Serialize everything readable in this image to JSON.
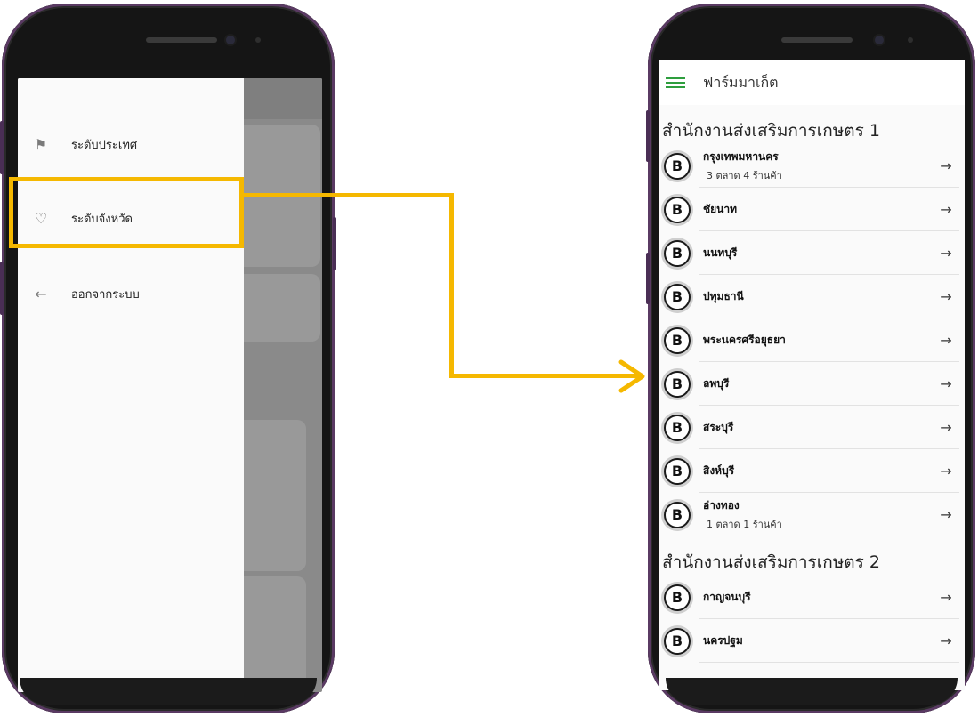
{
  "left_phone": {
    "drawer_items": [
      {
        "label": "ระดับประเทศ",
        "icon": "flag-icon"
      },
      {
        "label": "ระดับจังหวัด",
        "icon": "heart-icon"
      },
      {
        "label": "ออกจากระบบ",
        "icon": "arrow-left-icon"
      }
    ]
  },
  "right_phone": {
    "app_title": "ฟาร์มมาเก็ต",
    "sections": [
      {
        "title": "สำนักงานส่งเสริมการเกษตร 1",
        "items": [
          {
            "name": "กรุงเทพมหานคร",
            "sub": "3 ตลาด  4 ร้านค้า"
          },
          {
            "name": "ชัยนาท",
            "sub": ""
          },
          {
            "name": "นนทบุรี",
            "sub": ""
          },
          {
            "name": "ปทุมธานี",
            "sub": ""
          },
          {
            "name": "พระนครศรีอยุธยา",
            "sub": ""
          },
          {
            "name": "ลพบุรี",
            "sub": ""
          },
          {
            "name": "สระบุรี",
            "sub": ""
          },
          {
            "name": "สิงห์บุรี",
            "sub": ""
          },
          {
            "name": "อ่างทอง",
            "sub": "1 ตลาด  1 ร้านค้า"
          }
        ]
      },
      {
        "title": "สำนักงานส่งเสริมการเกษตร 2",
        "items": [
          {
            "name": "กาญจนบุรี",
            "sub": ""
          },
          {
            "name": "นครปฐม",
            "sub": ""
          }
        ]
      }
    ],
    "coin_glyph": "B",
    "arrow_glyph": "→"
  },
  "colors": {
    "highlight": "#f5b800",
    "menu_green": "#2e9e3e"
  }
}
